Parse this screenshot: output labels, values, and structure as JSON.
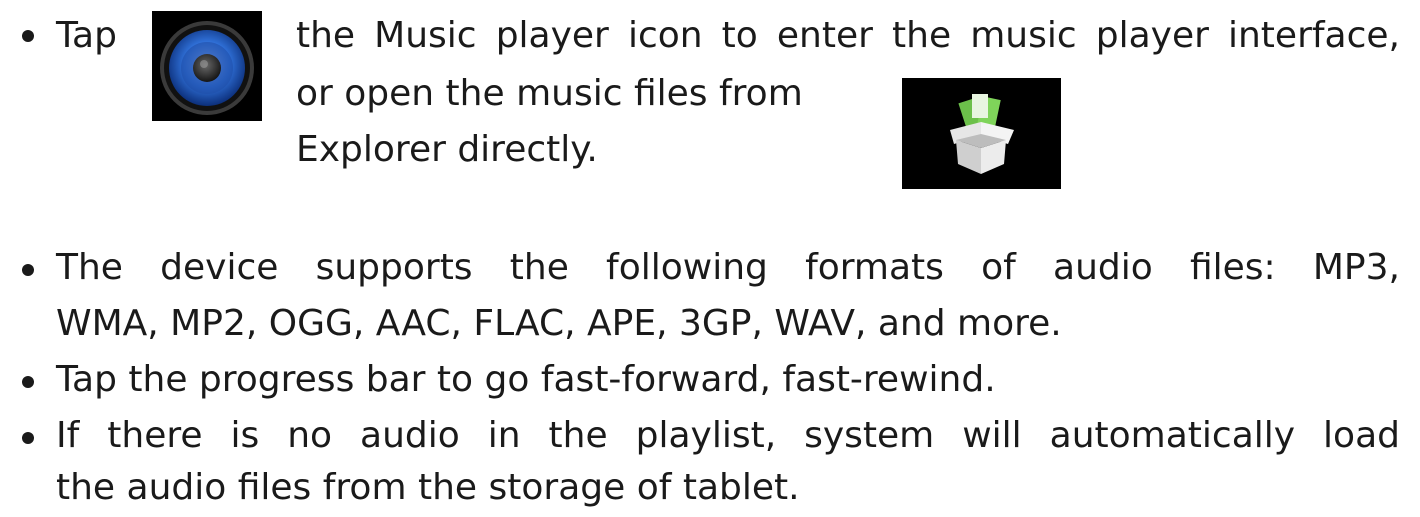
{
  "bullet1": {
    "lead": "Tap",
    "line1": "the Music player icon to enter the music player interface,",
    "line2": "or open the music files from",
    "line3": "Explorer directly."
  },
  "icons": {
    "music_player": "speaker-icon",
    "explorer": "box-icon"
  },
  "bullet2": {
    "line1": "The device supports the following formats of audio files: MP3,",
    "line2": "WMA, MP2, OGG, AAC, FLAC, APE, 3GP, WAV, and more."
  },
  "bullet3": {
    "line1": "Tap the progress bar to go fast-forward, fast-rewind."
  },
  "bullet4": {
    "line1": "If there is no audio in the playlist, system will automatically load",
    "line2": "the audio files from the storage of tablet."
  }
}
